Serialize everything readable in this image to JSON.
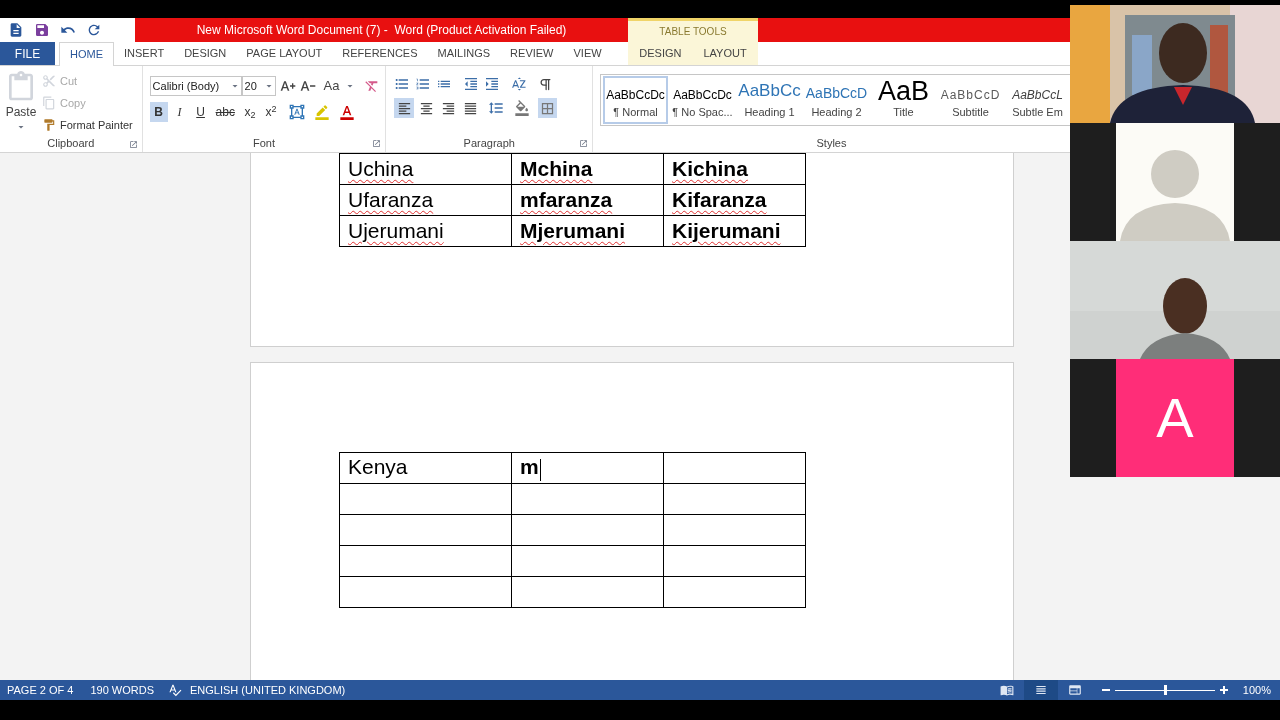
{
  "window": {
    "title": "New Microsoft Word Document (7) -  Word (Product Activation Failed)"
  },
  "table_tools": {
    "label": "TABLE TOOLS",
    "tabs": [
      {
        "label": "DESIGN",
        "selected": false
      },
      {
        "label": "LAYOUT",
        "selected": false
      }
    ]
  },
  "tabs": [
    {
      "label": "FILE",
      "kind": "file",
      "selected": false
    },
    {
      "label": "HOME",
      "kind": "tab",
      "selected": true
    },
    {
      "label": "INSERT",
      "kind": "tab",
      "selected": false
    },
    {
      "label": "DESIGN",
      "kind": "tab",
      "selected": false
    },
    {
      "label": "PAGE LAYOUT",
      "kind": "tab",
      "selected": false
    },
    {
      "label": "REFERENCES",
      "kind": "tab",
      "selected": false
    },
    {
      "label": "MAILINGS",
      "kind": "tab",
      "selected": false
    },
    {
      "label": "REVIEW",
      "kind": "tab",
      "selected": false
    },
    {
      "label": "VIEW",
      "kind": "tab",
      "selected": false
    }
  ],
  "clipboard": {
    "label": "Clipboard",
    "paste": "Paste",
    "actions": [
      {
        "kind": "cut",
        "label": "Cut",
        "disabled": true
      },
      {
        "kind": "copy",
        "label": "Copy",
        "disabled": true
      },
      {
        "kind": "painter",
        "label": "Format Painter",
        "disabled": false
      }
    ]
  },
  "font": {
    "label": "Font",
    "family": "Calibri (Body)",
    "size": "20",
    "change_case": "Aa",
    "format_buttons": [
      {
        "kind": "bold",
        "label": "B",
        "selected": true
      },
      {
        "kind": "italic",
        "label": "I",
        "selected": false
      },
      {
        "kind": "underline",
        "label": "U",
        "selected": false
      },
      {
        "kind": "strike",
        "label": "abc",
        "selected": false
      },
      {
        "kind": "sub",
        "label": "x$_{2}$",
        "selected": false
      },
      {
        "kind": "super",
        "label": "x$^{2}$",
        "selected": false
      }
    ]
  },
  "paragraph": {
    "label": "Paragraph",
    "alignments": [
      {
        "kind": "left",
        "selected": true
      },
      {
        "kind": "center",
        "selected": false
      },
      {
        "kind": "right",
        "selected": false
      },
      {
        "kind": "justify",
        "selected": false
      }
    ]
  },
  "styles": {
    "label": "Styles",
    "items": [
      {
        "kind": "normal",
        "preview": "AaBbCcDc",
        "name": "¶ Normal",
        "selected": true
      },
      {
        "kind": "normal",
        "preview": "AaBbCcDc",
        "name": "¶ No Spac...",
        "selected": false
      },
      {
        "kind": "heading1",
        "preview": "AaBbCc",
        "name": "Heading 1",
        "selected": false
      },
      {
        "kind": "heading2",
        "preview": "AaBbCcD",
        "name": "Heading 2",
        "selected": false
      },
      {
        "kind": "title",
        "preview": "AaB",
        "name": "Title",
        "selected": false
      },
      {
        "kind": "subtitle",
        "preview": "AaBbCcD",
        "name": "Subtitle",
        "selected": false
      },
      {
        "kind": "emphasis",
        "preview": "AaBbCcL",
        "name": "Subtle Em",
        "selected": false
      }
    ]
  },
  "document": {
    "page_1_table": [
      [
        {
          "text": "Uchina",
          "misspelled": true
        },
        {
          "text": "Mchina",
          "misspelled": true
        },
        {
          "text": "Kichina",
          "misspelled": true
        }
      ],
      [
        {
          "text": "Ufaranza",
          "misspelled": true
        },
        {
          "text": "mfaranza",
          "misspelled": true
        },
        {
          "text": "Kifaranza",
          "misspelled": true
        }
      ],
      [
        {
          "text": "Ujerumani",
          "misspelled": true
        },
        {
          "text": "Mjerumani",
          "misspelled": true
        },
        {
          "text": "Kijerumani",
          "misspelled": true
        }
      ]
    ],
    "page_2_table": [
      [
        {
          "text": "Kenya",
          "misspelled": false
        },
        {
          "text": "m",
          "misspelled": false,
          "cursor": true
        }
      ]
    ]
  },
  "status_bar": {
    "page": "PAGE 2 OF 4",
    "words": "190 WORDS",
    "language": "ENGLISH (UNITED KINGDOM)",
    "views": [
      {
        "kind": "read",
        "selected": false
      },
      {
        "kind": "print",
        "selected": true
      },
      {
        "kind": "web",
        "selected": false
      }
    ],
    "zoom": {
      "level": 0.5,
      "reading": "100%"
    }
  },
  "video_tiles": [
    {
      "kind": "camera"
    },
    {
      "kind": "avatar"
    },
    {
      "kind": "camera2"
    },
    {
      "kind": "initial",
      "initial": "A",
      "color": "#ff2d78"
    }
  ]
}
